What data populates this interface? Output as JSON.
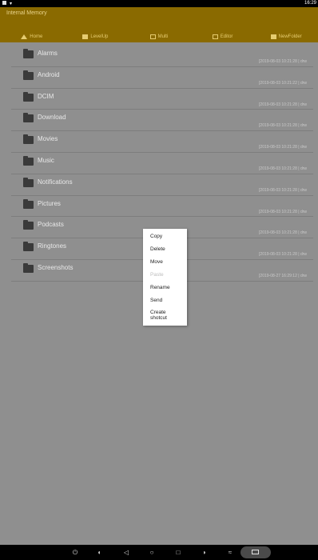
{
  "status": {
    "time": "16:29"
  },
  "header": {
    "title": "Internal Memory",
    "tabs": [
      {
        "label": "Home",
        "icon": "home-icon"
      },
      {
        "label": "LevelUp",
        "icon": "level-up-icon"
      },
      {
        "label": "Multi",
        "icon": "multi-select-icon"
      },
      {
        "label": "Editor",
        "icon": "editor-icon"
      },
      {
        "label": "NewFolder",
        "icon": "new-folder-icon"
      }
    ]
  },
  "files": [
    {
      "name": "Alarms",
      "meta": "[2019-08-03 10:21:28 | drw"
    },
    {
      "name": "Android",
      "meta": "[2019-08-03 10:21:22 | drw"
    },
    {
      "name": "DCIM",
      "meta": "[2019-08-03 10:21:28 | drw"
    },
    {
      "name": "Download",
      "meta": "[2019-08-03 10:21:28 | drw"
    },
    {
      "name": "Movies",
      "meta": "[2019-08-03 10:21:28 | drw"
    },
    {
      "name": "Music",
      "meta": "[2019-08-03 10:21:28 | drw"
    },
    {
      "name": "Notifications",
      "meta": "[2019-08-03 10:21:28 | drw"
    },
    {
      "name": "Pictures",
      "meta": "[2019-08-03 10:21:28 | drw"
    },
    {
      "name": "Podcasts",
      "meta": "[2019-08-03 10:21:28 | drw"
    },
    {
      "name": "Ringtones",
      "meta": "[2019-08-03 10:21:28 | drw"
    },
    {
      "name": "Screenshots",
      "meta": "[2019-08-27 16:29:12 | drw"
    }
  ],
  "context_menu": {
    "items": [
      {
        "label": "Copy",
        "enabled": true
      },
      {
        "label": "Delete",
        "enabled": true
      },
      {
        "label": "Move",
        "enabled": true
      },
      {
        "label": "Paste",
        "enabled": false
      },
      {
        "label": "Rename",
        "enabled": true
      },
      {
        "label": "Send",
        "enabled": true
      },
      {
        "label": "Create shotcut",
        "enabled": true
      }
    ]
  },
  "navbar": {
    "buttons": [
      "power-icon",
      "volume-down-icon",
      "back-icon",
      "home-circle-icon",
      "recents-icon",
      "volume-up-icon",
      "wifi-icon",
      "keyboard-icon"
    ]
  },
  "colors": {
    "header": "#8a6a00",
    "tab_text": "#e6cc70",
    "background": "#8f8f8f"
  }
}
